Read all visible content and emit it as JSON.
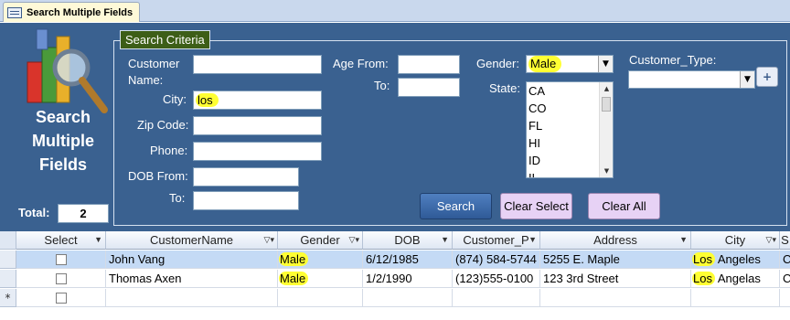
{
  "tab": {
    "label": "Search Multiple Fields",
    "icon": "form-icon"
  },
  "side": {
    "title_lines": [
      "Search",
      "Multiple",
      "Fields"
    ],
    "total_label": "Total:",
    "total_value": "2"
  },
  "criteria": {
    "legend": "Search Criteria",
    "customer_name_label_1": "Customer",
    "customer_name_label_2": "Name:",
    "customer_name_value": "",
    "city_label": "City:",
    "city_value": "los",
    "zip_label": "Zip Code:",
    "zip_value": "",
    "phone_label": "Phone:",
    "phone_value": "",
    "dob_from_label": "DOB From:",
    "dob_from_value": "",
    "dob_to_label": "To:",
    "dob_to_value": "",
    "age_from_label": "Age From:",
    "age_from_value": "",
    "age_to_label": "To:",
    "age_to_value": "",
    "gender_label": "Gender:",
    "gender_value": "Male",
    "state_label": "State:",
    "state_options": [
      "CA",
      "CO",
      "FL",
      "HI",
      "ID",
      "IL"
    ],
    "customer_type_label": "Customer_Type:",
    "customer_type_value": "",
    "plus_label": "+"
  },
  "buttons": {
    "search": "Search",
    "clear_select": "Clear Select",
    "clear_all": "Clear All"
  },
  "grid": {
    "columns": [
      "Select",
      "CustomerName",
      "Gender",
      "DOB",
      "Customer_P",
      "Address",
      "City",
      "S"
    ],
    "rows": [
      {
        "customer_name": "John Vang",
        "gender": "Male",
        "dob": "6/12/1985",
        "phone": "(874) 584-5744",
        "address": "5255 E. Maple",
        "city_a": "Los",
        "city_b": " Angeles",
        "s": "C"
      },
      {
        "customer_name": "Thomas Axen",
        "gender": "Male",
        "dob": "1/2/1990",
        "phone": "(123)555-0100",
        "address": "123 3rd Street",
        "city_a": "Los",
        "city_b": " Angelas",
        "s": "C"
      }
    ],
    "new_row_marker": "*"
  },
  "colors": {
    "form_bg": "#3a6190",
    "legend_bg": "#3d5e17",
    "highlight": "#ffff33",
    "selected_row": "#c4daf5"
  }
}
